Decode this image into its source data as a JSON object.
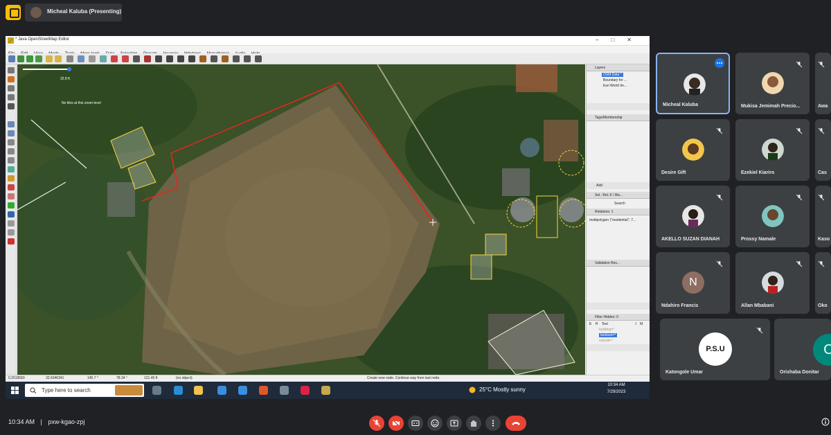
{
  "meet": {
    "presenter_label": "Micheal Kaluba (Presenting)",
    "time": "10:34 AM",
    "separator": "|",
    "meeting_code": "pxw-kgao-zpj"
  },
  "josm": {
    "window_title": "* Java OpenStreetMap Editor",
    "menu": [
      "File",
      "Edit",
      "View",
      "Mode",
      "Tools",
      "More tools",
      "Data",
      "Selection",
      "Presets",
      "Imagery",
      "Windows",
      "Mapathoner",
      "Audio",
      "Help"
    ],
    "scale_label": "32.8 ft",
    "zoom_notice": "No tiles at this zoom level",
    "layers_panel": {
      "title": "Layers",
      "items": [
        "OSM Data *",
        "Boundary for ...",
        "Esri World Im..."
      ]
    },
    "tags_panel": {
      "title": "Tags/Membership"
    },
    "add_button": "Add",
    "selection_panel": {
      "title": "Sel.: Rel.:0 / Wa...",
      "search": "Search",
      "relations_label": "Relations: 1",
      "relation_item": "multipolygon (\"residential\", 7..."
    },
    "validation_panel": {
      "title": "Validation Res..."
    },
    "filter_panel": {
      "title": "Filter Hidden: 0",
      "columns": [
        "E",
        "H",
        "Text",
        "I",
        "M"
      ],
      "rows": [
        "building=*",
        "landuse=*",
        "natural=*"
      ]
    },
    "status": {
      "lat": "0.2619583",
      "lon": "32.6346341",
      "heading": "145.7 °",
      "angle": "78.34 °",
      "distance": "121.45 ft",
      "selection": "(no object)",
      "hint": "Create new node. Continue way from last node."
    },
    "taskbar": {
      "search_placeholder": "Type here to search",
      "weather": "25°C  Mostly sunny",
      "time": "10:34 AM",
      "date": "7/29/2023"
    }
  },
  "participants": [
    {
      "name": "Micheal Kaluba",
      "muted": false
    },
    {
      "name": "Mukisa Jemimah Precio...",
      "muted": true
    },
    {
      "name": "Awa",
      "muted": true
    },
    {
      "name": "Desire Gift",
      "muted": true
    },
    {
      "name": "Ezekiel Kiariro",
      "muted": true
    },
    {
      "name": "Cas",
      "muted": true
    },
    {
      "name": "AKELLO SUZAN DIANAH",
      "muted": true
    },
    {
      "name": "Prossy Namale",
      "muted": true
    },
    {
      "name": "Kaso",
      "muted": true
    },
    {
      "name": "Ndahiro Francis",
      "initial": "N",
      "muted": true
    },
    {
      "name": "Allan Mbabani",
      "muted": true
    },
    {
      "name": "Oko",
      "muted": true
    },
    {
      "name": "Katongole Umar",
      "avatar_text": "P.S.U",
      "muted": true
    },
    {
      "name": "Orishaba Donitar",
      "initial": "O",
      "muted": false
    }
  ],
  "colors": {
    "meet_bg": "#202124",
    "tile_bg": "#3c4043",
    "active_border": "#8ab4f8",
    "red": "#ea4335",
    "draw_line": "#e0281e",
    "selection_yellow": "#f5d742"
  },
  "icons": [
    "present-icon",
    "mic-off-icon",
    "camera-off-icon",
    "captions-icon",
    "emoji-icon",
    "present-screen-icon",
    "hand-icon",
    "more-icon",
    "end-call-icon",
    "info-icon"
  ]
}
